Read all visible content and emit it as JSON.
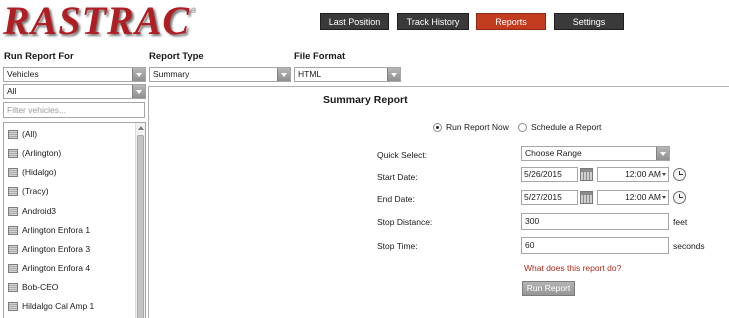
{
  "brand": {
    "logo_text": "RASTRAC",
    "logo_mark": "®",
    "logo_color": "#b01e23"
  },
  "nav": {
    "tabs": [
      {
        "label": "Last Position"
      },
      {
        "label": "Track History"
      },
      {
        "label": "Reports",
        "active": true
      },
      {
        "label": "Settings"
      }
    ],
    "active_color": "#c33c1f",
    "inactive_color": "#3a3a3a"
  },
  "filters": {
    "run_for_label": "Run Report For",
    "run_for_value": "Vehicles",
    "group_value": "All",
    "report_type_label": "Report Type",
    "report_type_value": "Summary",
    "file_format_label": "File Format",
    "file_format_value": "HTML"
  },
  "vehicle_panel": {
    "filter_placeholder": "Filter vehicles...",
    "vehicles": [
      "(All)",
      "(Arlington)",
      "(Hidalgo)",
      "(Tracy)",
      "Android3",
      "Arlington Enfora 1",
      "Arlington Enfora 3",
      "Arlington Enfora 4",
      "Bob-CEO",
      "Hildalgo Cal Amp 1"
    ]
  },
  "report": {
    "title": "Summary Report",
    "run_now_label": "Run Report Now",
    "run_now_selected": true,
    "schedule_label": "Schedule a Report",
    "quick_select_label": "Quick Select:",
    "quick_select_value": "Choose Range",
    "start_date_label": "Start Date:",
    "start_date": "5/26/2015",
    "start_time": "12:00 AM",
    "end_date_label": "End Date:",
    "end_date": "5/27/2015",
    "end_time": "12:00 AM",
    "stop_distance_label": "Stop Distance:",
    "stop_distance": "300",
    "stop_distance_unit": "feet",
    "stop_time_label": "Stop Time:",
    "stop_time": "60",
    "stop_time_unit": "seconds",
    "help_link": "What does this report do?",
    "run_button": "Run Report",
    "link_color": "#b02a1b"
  },
  "icons": {
    "calendar": "calendar-icon",
    "clock": "clock-icon",
    "vehicle": "vehicle-icon",
    "dropdown": "chevron-down-icon"
  }
}
